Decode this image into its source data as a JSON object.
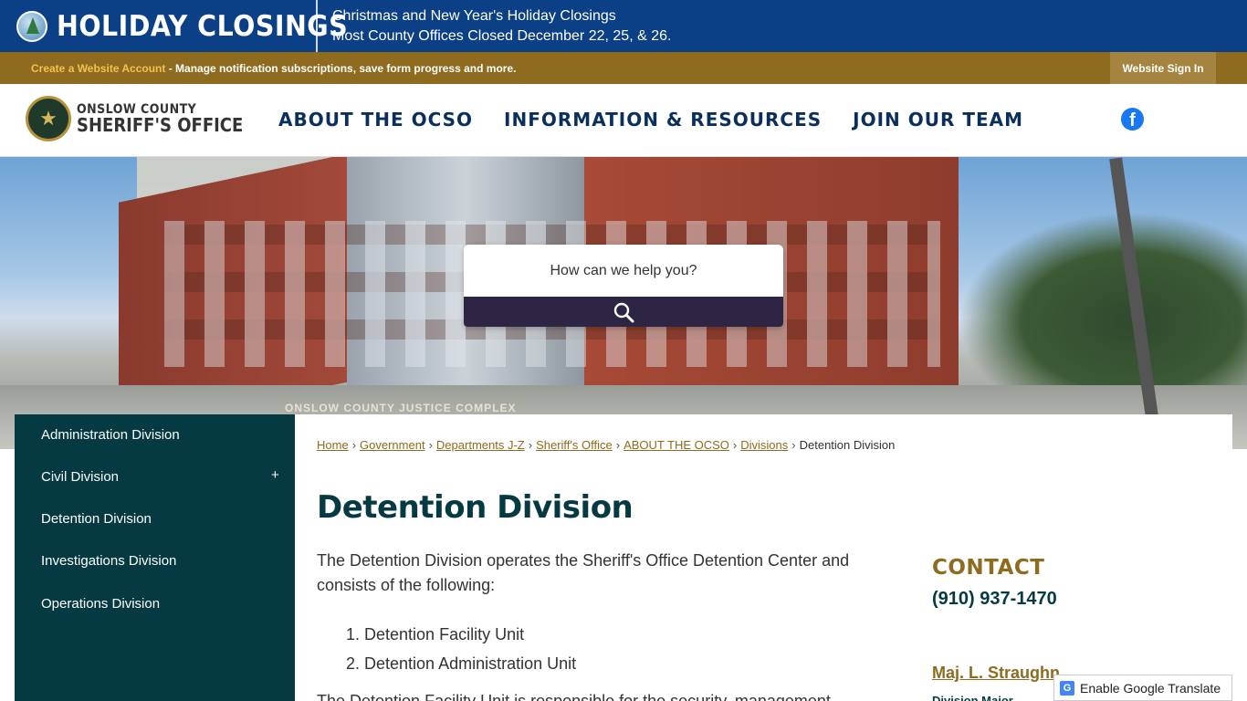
{
  "holiday": {
    "title": "HOLIDAY CLOSINGS",
    "line1": "Christmas and New Year's Holiday Closings",
    "line2": "Most County Offices Closed December 22, 25, & 26."
  },
  "account": {
    "create_link": "Create a Website Account",
    "message": " - Manage notification subscriptions, save form progress and more.",
    "signin": "Website Sign In"
  },
  "logo": {
    "line1": "ONSLOW COUNTY",
    "line2": "SHERIFF'S OFFICE"
  },
  "nav": {
    "items": [
      "ABOUT THE OCSO",
      "INFORMATION & RESOURCES",
      "JOIN OUR TEAM"
    ]
  },
  "hero": {
    "sign_text": "ONSLOW COUNTY JUSTICE COMPLEX"
  },
  "search": {
    "placeholder": "How can we help you?"
  },
  "sidebar": {
    "items": [
      {
        "label": "Administration Division"
      },
      {
        "label": "Civil Division",
        "expand": "+"
      },
      {
        "label": "Detention Division"
      },
      {
        "label": "Investigations Division"
      },
      {
        "label": "Operations Division"
      }
    ]
  },
  "breadcrumb": {
    "links": [
      "Home",
      "Government",
      "Departments J-Z",
      "Sheriff's Office",
      "ABOUT THE OCSO",
      "Divisions"
    ],
    "separator": "›",
    "current": "Detention Division"
  },
  "page": {
    "title": "Detention Division",
    "intro": "The Detention Division operates the Sheriff's Office Detention Center and consists of the following:",
    "units": [
      "Detention Facility Unit",
      "Detention Administration Unit"
    ],
    "cut_text": "The Detention Facility Unit is responsible for the security, management"
  },
  "contact": {
    "heading": "CONTACT",
    "phone": "(910) 937-1470",
    "name": "Maj. L. Straughn",
    "role": "Division Major"
  },
  "translate": {
    "label": "Enable Google Translate"
  },
  "colors": {
    "holiday_blue": "#0b3f86",
    "gold_bar": "#8f6b1f",
    "nav_navy": "#0b2f5c",
    "sidebar_teal": "#063a43",
    "search_button": "#2e2444"
  }
}
